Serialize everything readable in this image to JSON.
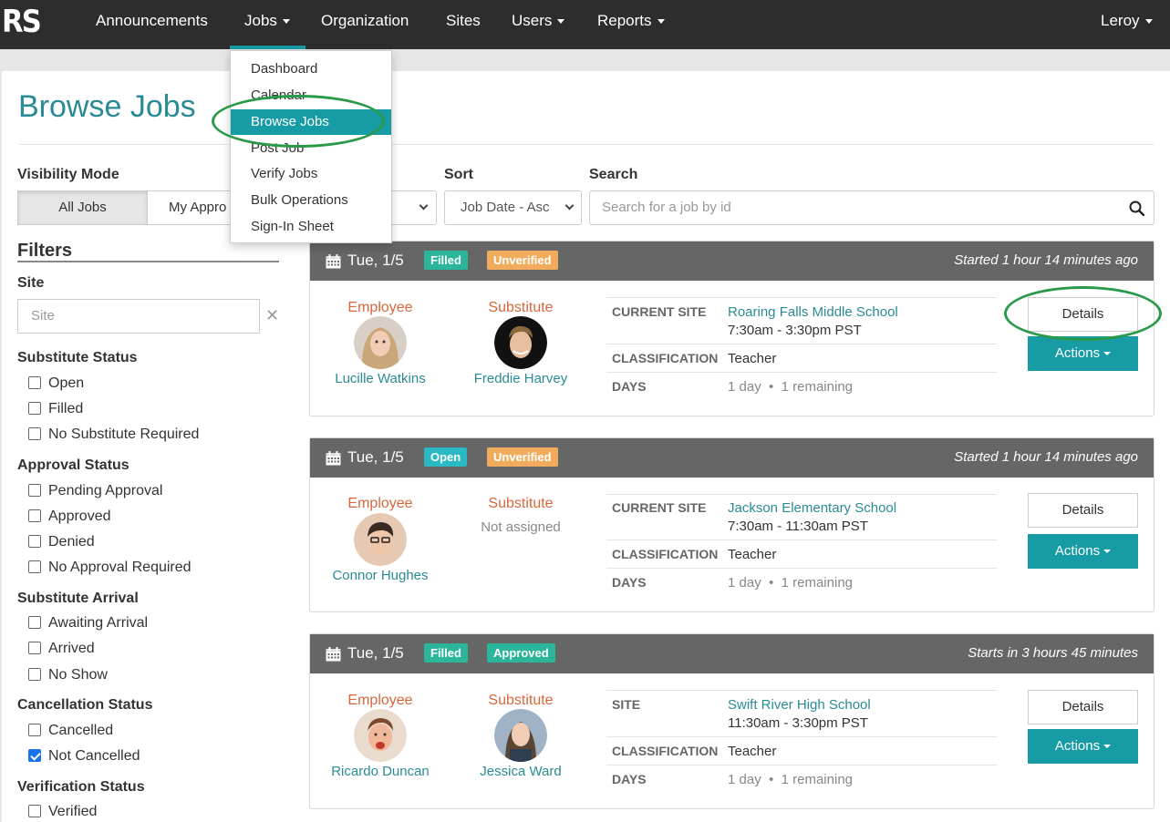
{
  "navbar": {
    "logo": "RS",
    "items": [
      {
        "label": "Announcements",
        "caret": false
      },
      {
        "label": "Jobs",
        "caret": true
      },
      {
        "label": "Organization",
        "caret": false
      },
      {
        "label": "Sites",
        "caret": false
      },
      {
        "label": "Users",
        "caret": true
      },
      {
        "label": "Reports",
        "caret": true
      }
    ],
    "user": "Leroy",
    "accent_color": "#179ba5"
  },
  "jobs_menu": {
    "items": [
      "Dashboard",
      "Calendar",
      "Browse Jobs",
      "Post Job",
      "Verify Jobs",
      "Bulk Operations",
      "Sign-In Sheet"
    ],
    "active": "Browse Jobs"
  },
  "page": {
    "title": "Browse Jobs"
  },
  "controls": {
    "visibility_label": "Visibility Mode",
    "visibility_options": [
      "All Jobs",
      "My Appro"
    ],
    "visibility_selected": "All Jobs",
    "sort_label": "Sort",
    "sort_value": "Job Date - Asc",
    "search_label": "Search",
    "search_placeholder": "Search for a job by id"
  },
  "filters": {
    "title": "Filters",
    "site_label": "Site",
    "site_placeholder": "Site",
    "groups": [
      {
        "label": "Substitute Status",
        "options": [
          {
            "label": "Open",
            "checked": false
          },
          {
            "label": "Filled",
            "checked": false
          },
          {
            "label": "No Substitute Required",
            "checked": false
          }
        ]
      },
      {
        "label": "Approval Status",
        "options": [
          {
            "label": "Pending Approval",
            "checked": false
          },
          {
            "label": "Approved",
            "checked": false
          },
          {
            "label": "Denied",
            "checked": false
          },
          {
            "label": "No Approval Required",
            "checked": false
          }
        ]
      },
      {
        "label": "Substitute Arrival",
        "options": [
          {
            "label": "Awaiting Arrival",
            "checked": false
          },
          {
            "label": "Arrived",
            "checked": false
          },
          {
            "label": "No Show",
            "checked": false
          }
        ]
      },
      {
        "label": "Cancellation Status",
        "options": [
          {
            "label": "Cancelled",
            "checked": false
          },
          {
            "label": "Not Cancelled",
            "checked": true
          }
        ]
      },
      {
        "label": "Verification Status",
        "options": [
          {
            "label": "Verified",
            "checked": false
          }
        ]
      }
    ]
  },
  "jobs": [
    {
      "date": "Tue, 1/5",
      "badges": [
        "Filled",
        "Unverified"
      ],
      "when": "Started 1 hour 14 minutes ago",
      "employee_label": "Employee",
      "employee": "Lucille Watkins",
      "substitute_label": "Substitute",
      "substitute": "Freddie Harvey",
      "site_key": "CURRENT SITE",
      "site": "Roaring Falls Middle School",
      "time": "7:30am - 3:30pm PST",
      "classification_key": "CLASSIFICATION",
      "classification": "Teacher",
      "days_key": "DAYS",
      "days": "1 day",
      "remaining": "1 remaining",
      "details_label": "Details",
      "actions_label": "Actions"
    },
    {
      "date": "Tue, 1/5",
      "badges": [
        "Open",
        "Unverified"
      ],
      "when": "Started 1 hour 14 minutes ago",
      "employee_label": "Employee",
      "employee": "Connor Hughes",
      "substitute_label": "Substitute",
      "substitute": "Not assigned",
      "site_key": "CURRENT SITE",
      "site": "Jackson Elementary School",
      "time": "7:30am - 11:30am PST",
      "classification_key": "CLASSIFICATION",
      "classification": "Teacher",
      "days_key": "DAYS",
      "days": "1 day",
      "remaining": "1 remaining",
      "details_label": "Details",
      "actions_label": "Actions"
    },
    {
      "date": "Tue, 1/5",
      "badges": [
        "Filled",
        "Approved"
      ],
      "when": "Starts in 3 hours 45 minutes",
      "employee_label": "Employee",
      "employee": "Ricardo Duncan",
      "substitute_label": "Substitute",
      "substitute": "Jessica Ward",
      "site_key": "SITE",
      "site": "Swift River High School",
      "time": "11:30am - 3:30pm PST",
      "classification_key": "CLASSIFICATION",
      "classification": "Teacher",
      "days_key": "DAYS",
      "days": "1 day",
      "remaining": "1 remaining",
      "details_label": "Details",
      "actions_label": "Actions"
    }
  ]
}
